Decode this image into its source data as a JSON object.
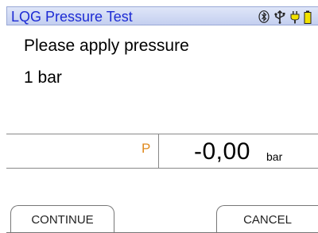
{
  "header": {
    "title": "LQG Pressure Test",
    "icons": [
      "bluetooth-icon",
      "usb-icon",
      "plug-icon",
      "battery-icon"
    ]
  },
  "message": {
    "line1": "Please apply pressure",
    "line2": "1 bar"
  },
  "measurement": {
    "symbol": "P",
    "value": "-0,00",
    "unit": "bar"
  },
  "softkeys": {
    "left_label": "CONTINUE",
    "right_label": "CANCEL"
  },
  "colors": {
    "title_text": "#1d2bd4",
    "title_bar": "#c4cff0",
    "symbol": "#e08a1e",
    "battery": "#f2e200"
  }
}
